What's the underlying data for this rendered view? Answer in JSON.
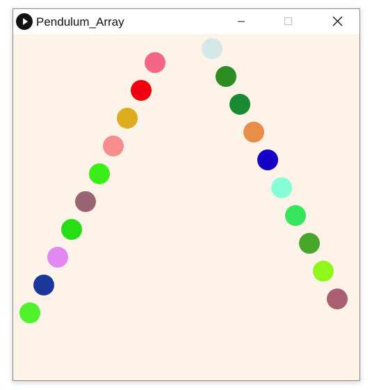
{
  "window": {
    "title": "Pendulum_Array",
    "controls": [
      {
        "name": "minimize",
        "icon": "minimize-icon"
      },
      {
        "name": "maximize",
        "icon": "maximize-icon"
      },
      {
        "name": "close",
        "icon": "close-icon"
      }
    ]
  },
  "canvas": {
    "background": "#fdf3e8"
  },
  "pendulum_bobs": [
    {
      "color": "#f46685"
    },
    {
      "color": "#f0000f"
    },
    {
      "color": "#dbad1f"
    },
    {
      "color": "#f58e8c"
    },
    {
      "color": "#3bee1a"
    },
    {
      "color": "#9a6473"
    },
    {
      "color": "#27dd13"
    },
    {
      "color": "#e189f0"
    },
    {
      "color": "#1a369b"
    },
    {
      "color": "#4ff22c"
    },
    {
      "color": "#d4e8e8"
    },
    {
      "color": "#2d8c22"
    },
    {
      "color": "#178a32"
    },
    {
      "color": "#e88d4a"
    },
    {
      "color": "#1400c6"
    },
    {
      "color": "#86ffd8"
    },
    {
      "color": "#35e65c"
    },
    {
      "color": "#46a72a"
    },
    {
      "color": "#8ff719"
    },
    {
      "color": "#a95f71"
    }
  ]
}
